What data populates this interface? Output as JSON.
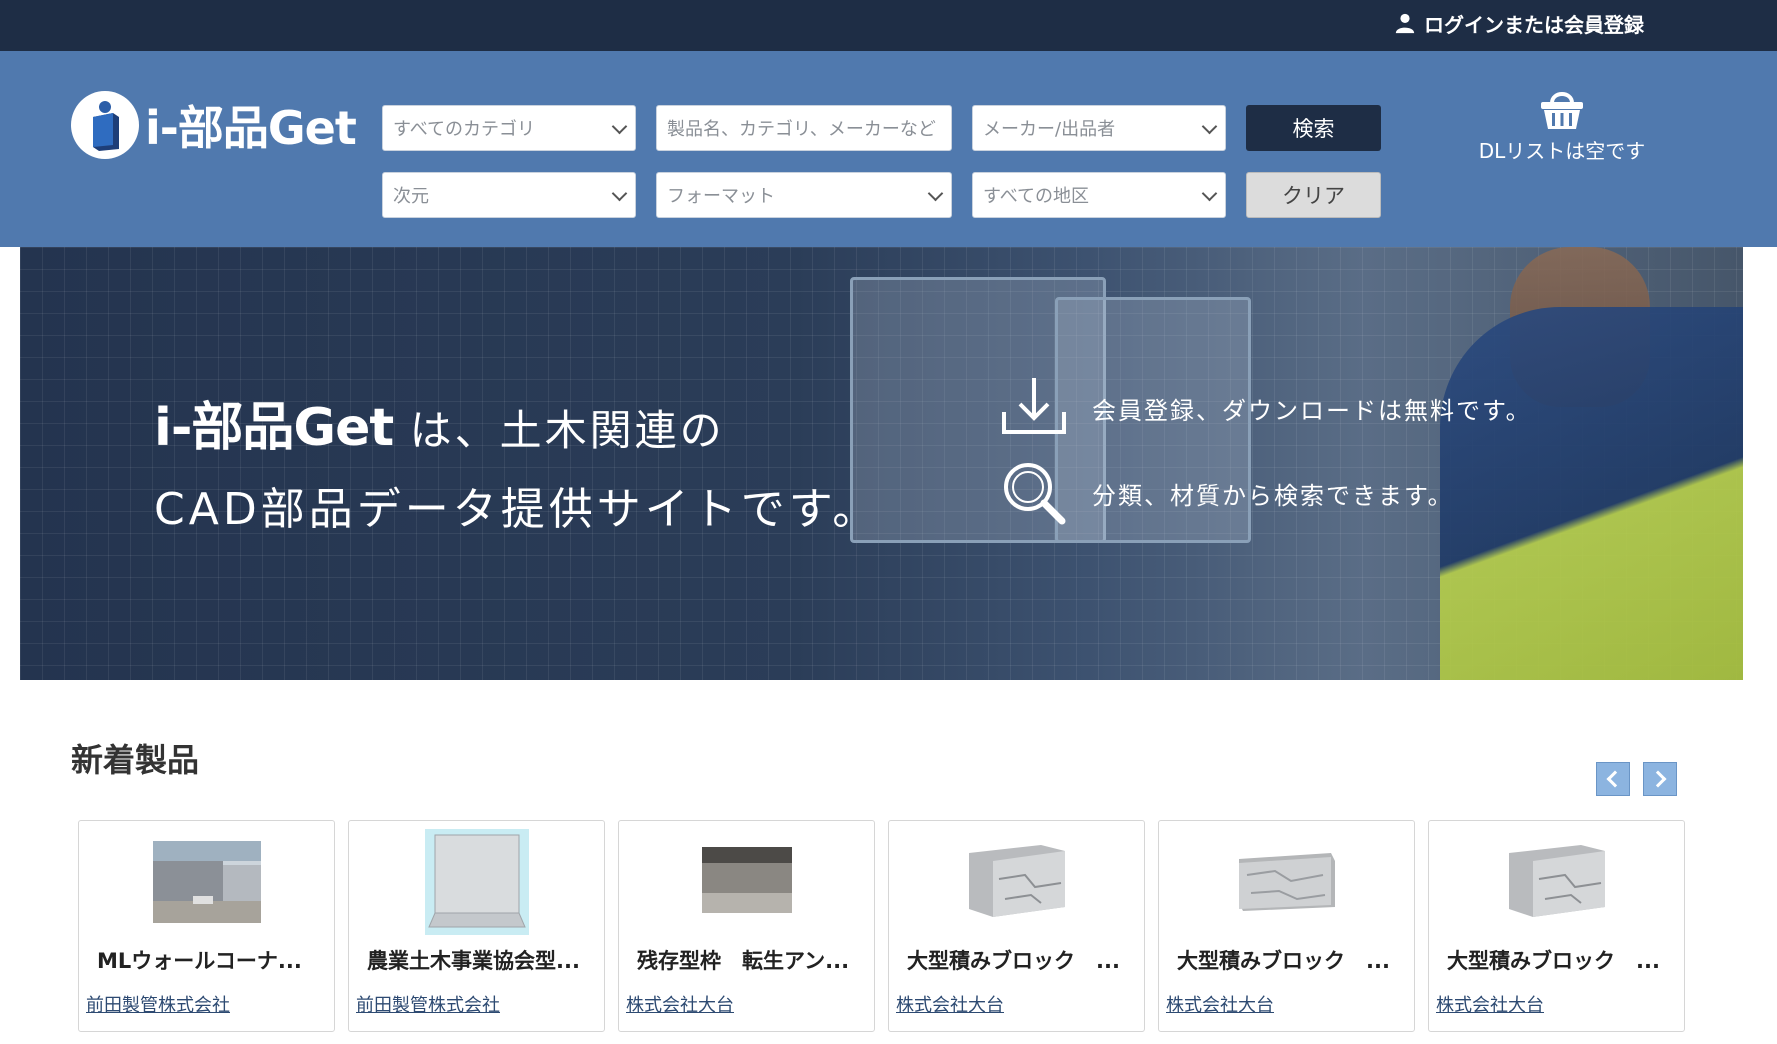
{
  "topbar": {
    "login_label": "ログインまたは会員登録"
  },
  "header": {
    "logo_text": "i-部品Get",
    "category_select": "すべてのカテゴリ",
    "search_placeholder": "製品名、カテゴリ、メーカーなど",
    "maker_select": "メーカー/出品者",
    "search_button": "検索",
    "dimension_select": "次元",
    "format_select": "フォーマット",
    "region_select": "すべての地区",
    "clear_button": "クリア",
    "dl_list_label": "DLリストは空です"
  },
  "hero": {
    "brand": "i-部品Get",
    "line1_rest": " は、土木関連の",
    "line2": "CAD部品データ提供サイトです。",
    "feature1": "会員登録、ダウンロードは無料です。",
    "feature2": "分類、材質から検索できます。"
  },
  "new_products": {
    "title": "新着製品",
    "items": [
      {
        "name": "MLウォールコーナ...",
        "maker": "前田製管株式会社"
      },
      {
        "name": "農業土木事業協会型...",
        "maker": "前田製管株式会社"
      },
      {
        "name": "残存型枠　転生アン...",
        "maker": "株式会社大台"
      },
      {
        "name": "大型積みブロック　...",
        "maker": "株式会社大台"
      },
      {
        "name": "大型積みブロック　...",
        "maker": "株式会社大台"
      },
      {
        "name": "大型積みブロック　...",
        "maker": "株式会社大台"
      }
    ]
  },
  "colors": {
    "topbar": "#1e2d45",
    "header": "#5079ae",
    "accent_dark": "#1e2d45",
    "nav_button": "#8cb4e0"
  }
}
